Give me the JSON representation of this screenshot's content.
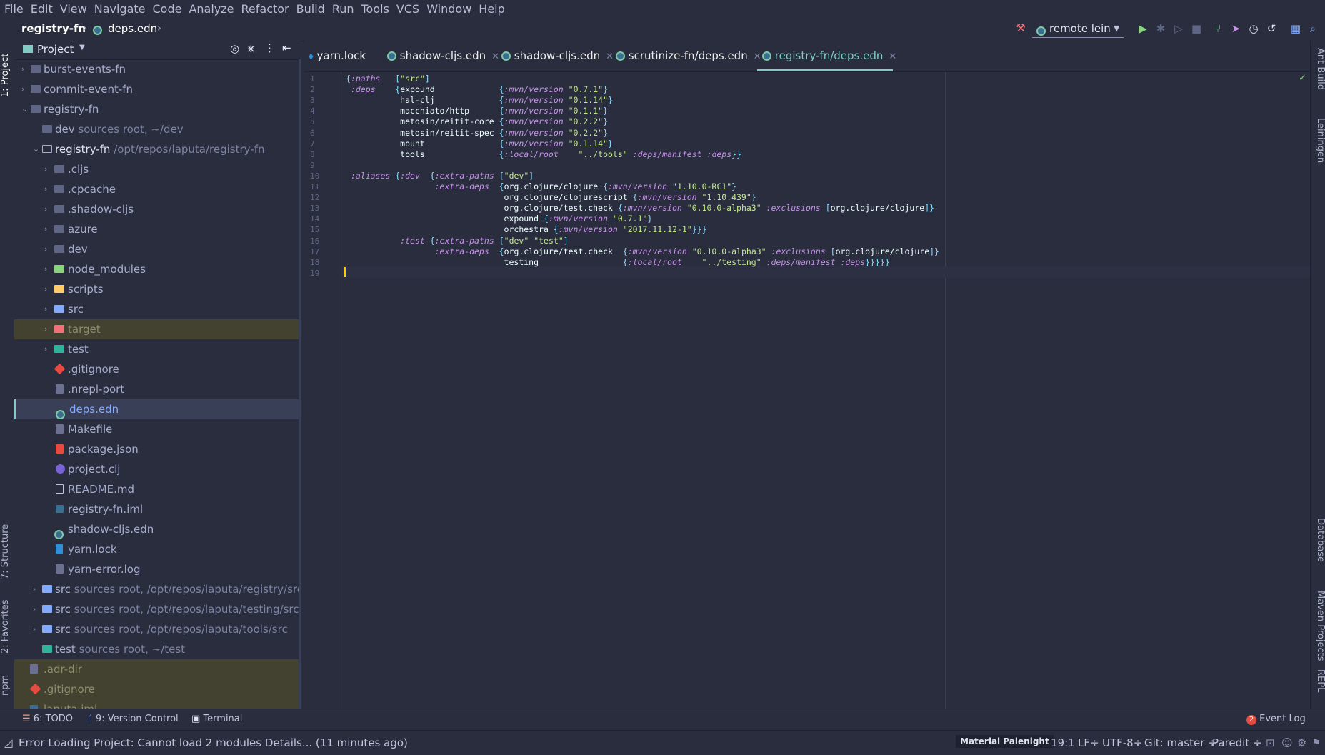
{
  "menu": [
    "File",
    "Edit",
    "View",
    "Navigate",
    "Code",
    "Analyze",
    "Refactor",
    "Build",
    "Run",
    "Tools",
    "VCS",
    "Window",
    "Help"
  ],
  "breadcrumb": {
    "project": "registry-fn",
    "file": "deps.edn"
  },
  "run_config": "remote lein",
  "project_panel": {
    "title": "Project",
    "items": [
      {
        "label": "burst-events-fn",
        "hint": ""
      },
      {
        "label": "commit-event-fn",
        "hint": ""
      },
      {
        "label": "registry-fn",
        "hint": ""
      },
      {
        "label": "dev",
        "hint": "sources root, ~/dev"
      },
      {
        "label": "registry-fn",
        "hint": "/opt/repos/laputa/registry-fn"
      },
      {
        "label": ".cljs",
        "hint": ""
      },
      {
        "label": ".cpcache",
        "hint": ""
      },
      {
        "label": ".shadow-cljs",
        "hint": ""
      },
      {
        "label": "azure",
        "hint": ""
      },
      {
        "label": "dev",
        "hint": ""
      },
      {
        "label": "node_modules",
        "hint": ""
      },
      {
        "label": "scripts",
        "hint": ""
      },
      {
        "label": "src",
        "hint": ""
      },
      {
        "label": "target",
        "hint": ""
      },
      {
        "label": "test",
        "hint": ""
      },
      {
        "label": ".gitignore",
        "hint": ""
      },
      {
        "label": ".nrepl-port",
        "hint": ""
      },
      {
        "label": "deps.edn",
        "hint": ""
      },
      {
        "label": "Makefile",
        "hint": ""
      },
      {
        "label": "package.json",
        "hint": ""
      },
      {
        "label": "project.clj",
        "hint": ""
      },
      {
        "label": "README.md",
        "hint": ""
      },
      {
        "label": "registry-fn.iml",
        "hint": ""
      },
      {
        "label": "shadow-cljs.edn",
        "hint": ""
      },
      {
        "label": "yarn.lock",
        "hint": ""
      },
      {
        "label": "yarn-error.log",
        "hint": ""
      },
      {
        "label": "src",
        "hint": "sources root, /opt/repos/laputa/registry/src"
      },
      {
        "label": "src",
        "hint": "sources root, /opt/repos/laputa/testing/src"
      },
      {
        "label": "src",
        "hint": "sources root, /opt/repos/laputa/tools/src"
      },
      {
        "label": "test",
        "hint": "sources root, ~/test"
      },
      {
        "label": ".adr-dir",
        "hint": ""
      },
      {
        "label": ".gitignore",
        "hint": ""
      },
      {
        "label": "laputa.iml",
        "hint": ""
      }
    ]
  },
  "tabs": [
    "yarn.lock",
    "shadow-cljs.edn",
    "shadow-cljs.edn",
    "scrutinize-fn/deps.edn",
    "registry-fn/deps.edn"
  ],
  "left_stripe": {
    "project": "1: Project",
    "structure": "7: Structure",
    "favorites": "2: Favorites",
    "npm": "npm"
  },
  "right_stripe": {
    "ant": "Ant Build",
    "lein": "Leiningen",
    "db": "Database",
    "maven": "Maven Projects",
    "repl": "REPL"
  },
  "code_lines": [
    "{:paths   [\"src\"]",
    " :deps    {expound             {:mvn/version \"0.7.1\"}",
    "           hal-clj             {:mvn/version \"0.1.14\"}",
    "           macchiato/http      {:mvn/version \"0.1.1\"}",
    "           metosin/reitit-core {:mvn/version \"0.2.2\"}",
    "           metosin/reitit-spec {:mvn/version \"0.2.2\"}",
    "           mount               {:mvn/version \"0.1.14\"}",
    "           tools               {:local/root    \"../tools\" :deps/manifest :deps}}",
    "",
    " :aliases {:dev  {:extra-paths [\"dev\"]",
    "                  :extra-deps  {org.clojure/clojure {:mvn/version \"1.10.0-RC1\"}",
    "                                org.clojure/clojurescript {:mvn/version \"1.10.439\"}",
    "                                org.clojure/test.check {:mvn/version \"0.10.0-alpha3\" :exclusions [org.clojure/clojure]}",
    "                                expound {:mvn/version \"0.7.1\"}",
    "                                orchestra {:mvn/version \"2017.11.12-1\"}}}",
    "           :test {:extra-paths [\"dev\" \"test\"]",
    "                  :extra-deps  {org.clojure/test.check  {:mvn/version \"0.10.0-alpha3\" :exclusions [org.clojure/clojure]}",
    "                                testing                 {:local/root    \"../testing\" :deps/manifest :deps}}}}}",
    ""
  ],
  "bottom_tools": {
    "todo": "6: TODO",
    "vcs": "9: Version Control",
    "terminal": "Terminal",
    "event_count": "2",
    "event_log": "Event Log"
  },
  "status": {
    "message": "Error Loading Project: Cannot load 2 modules Details... (11 minutes ago)",
    "theme": "Material Palenight",
    "position": "19:1",
    "line_sep": "LF÷",
    "encoding": "UTF-8÷",
    "git": "Git: master ÷",
    "mode": "Paredit ÷"
  },
  "colors": {
    "bg": "#292d3e",
    "accent": "#80cbc4",
    "keyword": "#c792ea",
    "string": "#c3e88d"
  }
}
